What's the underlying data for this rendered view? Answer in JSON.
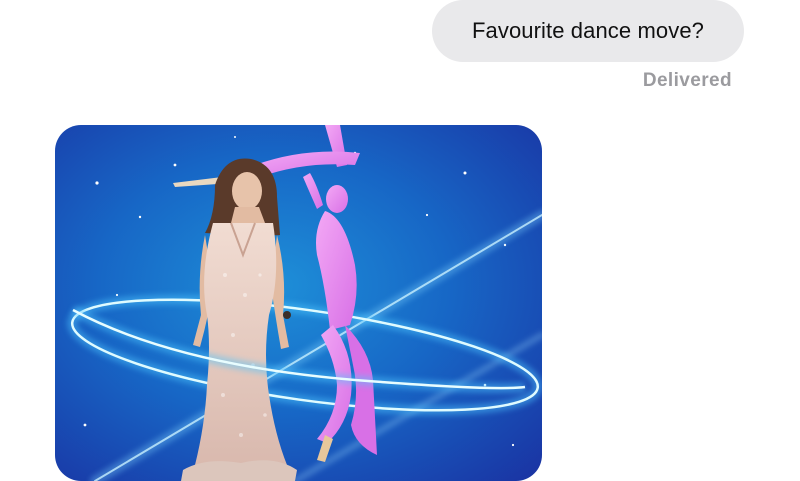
{
  "conversation": {
    "sent_message": {
      "text": "Favourite dance move?",
      "status": "Delivered"
    },
    "received_message": {
      "type": "gif-image"
    }
  },
  "colors": {
    "sent_bubble": "#e9e9eb",
    "sent_text": "#111111",
    "status_text": "#9b9b9f",
    "gif_background": "#1a63c9",
    "neon_ring": "#7fe8ff",
    "pink_figure": "#e88cf0"
  }
}
